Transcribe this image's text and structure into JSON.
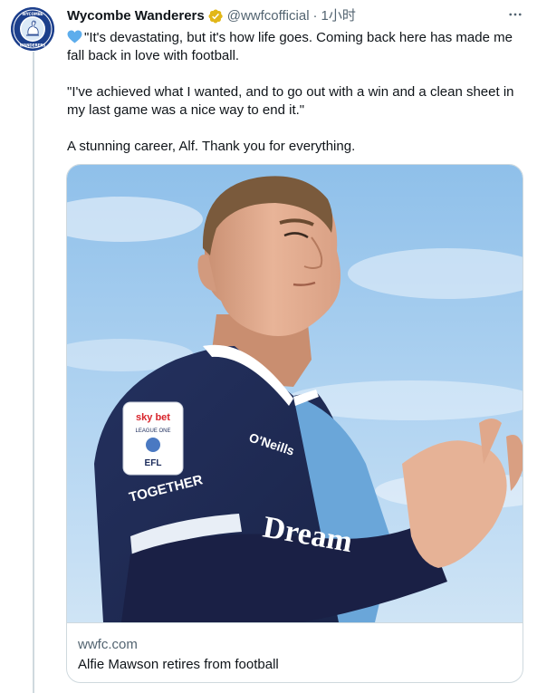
{
  "tweet": {
    "author": {
      "display_name": "Wycombe Wanderers",
      "handle": "@wwfcofficial",
      "verified": true,
      "verified_color": "#e2b719",
      "avatar_color": "#1a3a8a",
      "avatar_text_top": "WYCOMBE",
      "avatar_text_bottom": "WANDERERS"
    },
    "separator": "·",
    "timestamp": "1小时",
    "more_icon": "more-horizontal-icon",
    "body": {
      "emoji": "blue-heart-icon",
      "emoji_color": "#5dadec",
      "paragraphs": [
        "\"It's devastating, but it's how life goes. Coming back here has made me fall back in love with football.",
        "\"I've achieved what I wanted, and to go out with a win and a clean sheet in my last game was a nice way to end it.\"",
        "A stunning career, Alf. Thank you for everything."
      ]
    },
    "card": {
      "image_icon": "player-photo",
      "sponsor_text": "Dream",
      "kit_brand": "O'Neills",
      "badge_top": "sky bet",
      "badge_league": "LEAGUE ONE",
      "badge_efl": "EFL",
      "sleeve_text": "TOGETHER",
      "domain": "wwfc.com",
      "title": "Alfie Mawson retires from football"
    }
  }
}
